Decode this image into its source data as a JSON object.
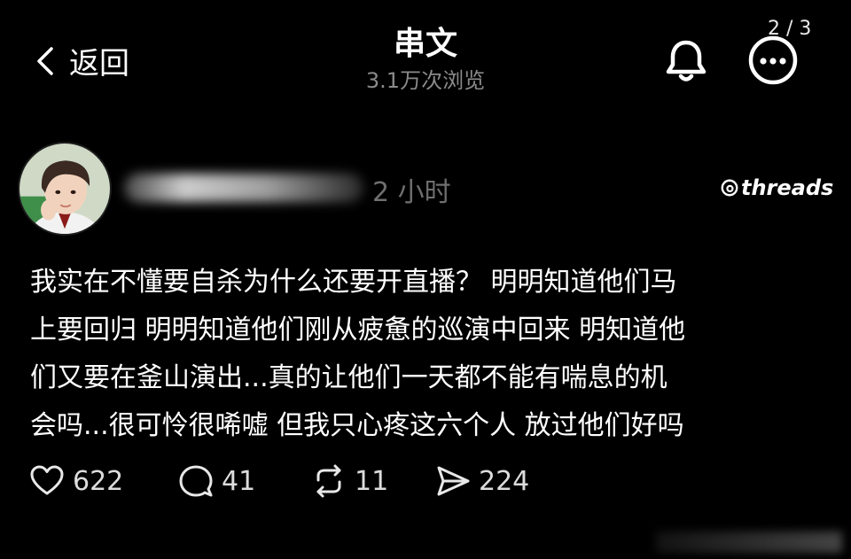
{
  "header": {
    "back_label": "返回",
    "title": "串文",
    "views": "3.1万次浏览",
    "page_indicator": "2 / 3"
  },
  "post": {
    "time": "2 小时",
    "brand": "threads",
    "lines": [
      "我实在不懂要自杀为什么还要开直播？ 明明知道他们马",
      "上要回归 明明知道他们刚从疲惫的巡演中回来 明知道他",
      "们又要在釜山演出...真的让他们一天都不能有喘息的机",
      "会吗...很可怜很唏嘘 但我只心疼这六个人 放过他们好吗"
    ]
  },
  "actions": {
    "likes": "622",
    "comments": "41",
    "reposts": "11",
    "shares": "224"
  },
  "icons": {
    "back": "chevron-left-icon",
    "bell": "bell-icon",
    "more": "more-icon",
    "brand": "threads-logo-icon",
    "like": "heart-icon",
    "comment": "comment-icon",
    "repost": "repost-icon",
    "share": "send-icon"
  },
  "colors": {
    "background": "#000000",
    "text": "#ffffff",
    "muted": "#8a8a8a"
  }
}
